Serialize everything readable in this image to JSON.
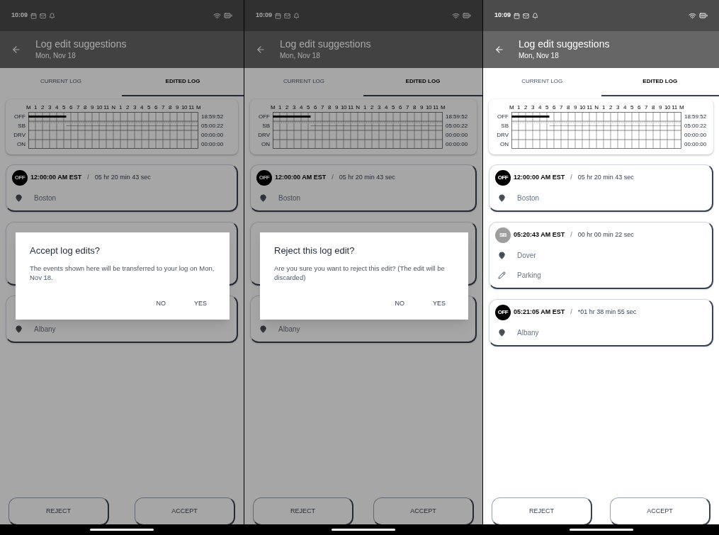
{
  "screens": [
    {
      "status_bar": {
        "time": "10:09"
      },
      "app_bar": {
        "title": "Log edit suggestions",
        "subtitle": "Mon, Nov 18"
      },
      "tabs": [
        {
          "label": "CURRENT LOG",
          "selected": false
        },
        {
          "label": "EDITED LOG",
          "selected": true
        }
      ],
      "log_graph": {
        "hours": [
          "M",
          "1",
          "2",
          "3",
          "4",
          "5",
          "6",
          "7",
          "8",
          "9",
          "10",
          "11",
          "N",
          "1",
          "2",
          "3",
          "4",
          "5",
          "6",
          "7",
          "8",
          "9",
          "10",
          "11",
          "M"
        ],
        "rows": [
          "OFF",
          "SB",
          "DRV",
          "ON"
        ],
        "totals": [
          "18:59:52",
          "05:00:22",
          "00:00:00",
          "00:00:00"
        ]
      },
      "events": [
        {
          "kind": "full",
          "status": "OFF",
          "color": "#000000",
          "time": "12:00:00 AM EST",
          "separator": "/",
          "duration": "05 hr 20 min 43 sec",
          "details": [
            {
              "kind": "location",
              "text": "Boston"
            }
          ]
        },
        {
          "kind": "covered"
        },
        {
          "kind": "partial",
          "details": [
            {
              "kind": "location",
              "text": "Albany"
            }
          ]
        }
      ],
      "dimmed": true,
      "dialog": {
        "title": "Accept log edits?",
        "message": "The events shown here will be transferred to your log on Mon, Nov 18.",
        "buttons": [
          "NO",
          "YES"
        ]
      },
      "buttons": [
        "REJECT",
        "ACCEPT"
      ]
    },
    {
      "status_bar": {
        "time": "10:09"
      },
      "app_bar": {
        "title": "Log edit suggestions",
        "subtitle": "Mon, Nov 18"
      },
      "tabs": [
        {
          "label": "CURRENT LOG",
          "selected": false
        },
        {
          "label": "EDITED LOG",
          "selected": true
        }
      ],
      "log_graph": {
        "hours": [
          "M",
          "1",
          "2",
          "3",
          "4",
          "5",
          "6",
          "7",
          "8",
          "9",
          "10",
          "11",
          "N",
          "1",
          "2",
          "3",
          "4",
          "5",
          "6",
          "7",
          "8",
          "9",
          "10",
          "11",
          "M"
        ],
        "rows": [
          "OFF",
          "SB",
          "DRV",
          "ON"
        ],
        "totals": [
          "18:59:52",
          "05:00:22",
          "00:00:00",
          "00:00:00"
        ]
      },
      "events": [
        {
          "kind": "full",
          "status": "OFF",
          "color": "#000000",
          "time": "12:00:00 AM EST",
          "separator": "/",
          "duration": "05 hr 20 min 43 sec",
          "details": [
            {
              "kind": "location",
              "text": "Boston"
            }
          ]
        },
        {
          "kind": "covered"
        },
        {
          "kind": "partial",
          "details": [
            {
              "kind": "location",
              "text": "Albany"
            }
          ]
        }
      ],
      "dimmed": true,
      "dialog": {
        "title": "Reject this log edit?",
        "message": "Are you sure you want to reject this edit? (The edit will be discarded)",
        "buttons": [
          "NO",
          "YES"
        ]
      },
      "buttons": [
        "REJECT",
        "ACCEPT"
      ]
    },
    {
      "status_bar": {
        "time": "10:09"
      },
      "app_bar": {
        "title": "Log edit suggestions",
        "subtitle": "Mon, Nov 18"
      },
      "tabs": [
        {
          "label": "CURRENT LOG",
          "selected": false
        },
        {
          "label": "EDITED LOG",
          "selected": true
        }
      ],
      "log_graph": {
        "hours": [
          "M",
          "1",
          "2",
          "3",
          "4",
          "5",
          "6",
          "7",
          "8",
          "9",
          "10",
          "11",
          "N",
          "1",
          "2",
          "3",
          "4",
          "5",
          "6",
          "7",
          "8",
          "9",
          "10",
          "11",
          "M"
        ],
        "rows": [
          "OFF",
          "SB",
          "DRV",
          "ON"
        ],
        "totals": [
          "18:59:52",
          "05:00:22",
          "00:00:00",
          "00:00:00"
        ]
      },
      "events": [
        {
          "kind": "full",
          "status": "OFF",
          "color": "#000000",
          "time": "12:00:00 AM EST",
          "separator": "/",
          "duration": "05 hr 20 min 43 sec",
          "details": [
            {
              "kind": "location",
              "text": "Boston"
            }
          ]
        },
        {
          "kind": "full",
          "status": "SB",
          "color": "#9e9e9e",
          "time": "05:20:43 AM EST",
          "separator": "/",
          "duration": "00 hr 00 min 22 sec",
          "details": [
            {
              "kind": "location",
              "text": "Dover"
            },
            {
              "kind": "note",
              "text": "Parking"
            }
          ]
        },
        {
          "kind": "full",
          "status": "OFF",
          "color": "#000000",
          "time": "05:21:05 AM EST",
          "separator": "/",
          "duration": "*01 hr 38 min 55 sec",
          "details": [
            {
              "kind": "location",
              "text": "Albany"
            }
          ]
        }
      ],
      "dimmed": false,
      "buttons": [
        "REJECT",
        "ACCEPT"
      ]
    }
  ]
}
